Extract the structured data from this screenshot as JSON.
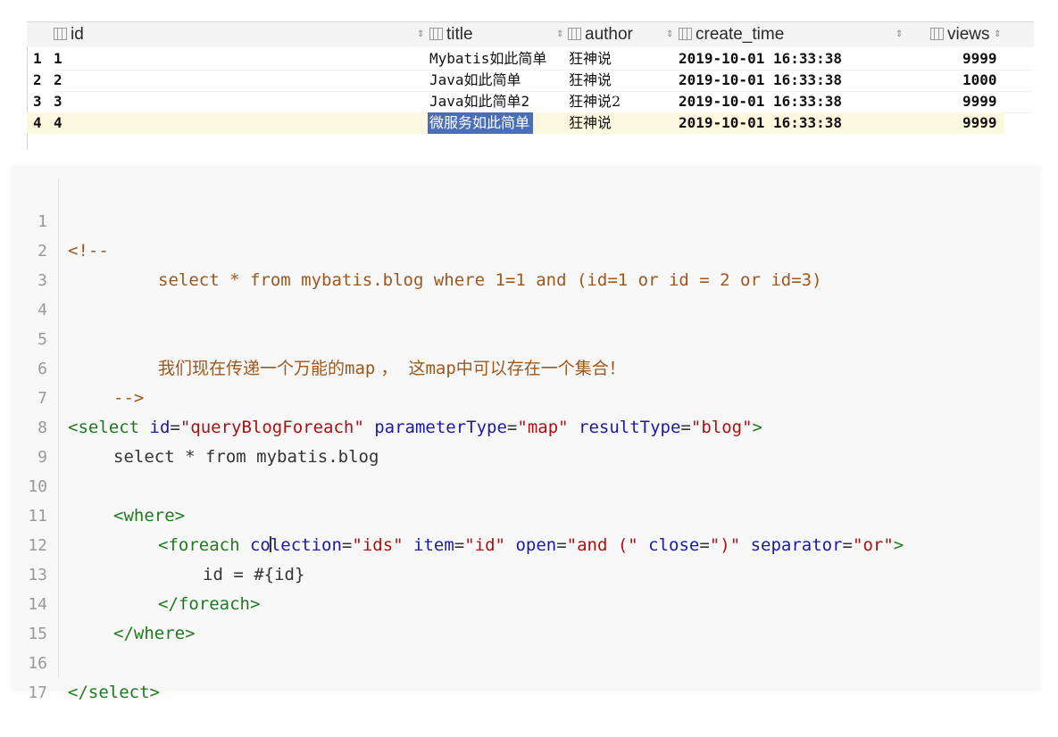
{
  "grid": {
    "columns": [
      {
        "name": "id"
      },
      {
        "name": "title"
      },
      {
        "name": "author"
      },
      {
        "name": "create_time"
      },
      {
        "name": "views"
      }
    ],
    "rows": [
      {
        "num": "1",
        "id": "1",
        "title": "Mybatis如此简单",
        "author": "狂神说",
        "create_time": "2019-10-01 16:33:38",
        "views": "9999"
      },
      {
        "num": "2",
        "id": "2",
        "title": "Java如此简单",
        "author": "狂神说",
        "create_time": "2019-10-01 16:33:38",
        "views": "1000"
      },
      {
        "num": "3",
        "id": "3",
        "title": "Java如此简单2",
        "author": "狂神说2",
        "create_time": "2019-10-01 16:33:38",
        "views": "9999"
      },
      {
        "num": "4",
        "id": "4",
        "title": "微服务如此简单",
        "author": "狂神说",
        "create_time": "2019-10-01 16:33:38",
        "views": "9999"
      }
    ],
    "selected_row": 4
  },
  "code": {
    "line_numbers": [
      "1",
      "2",
      "3",
      "4",
      "5",
      "6",
      "7",
      "8",
      "9",
      "10",
      "11",
      "12",
      "13",
      "14",
      "15",
      "16",
      "17"
    ],
    "l1": "<!--",
    "l2": "select * from mybatis.blog where 1=1 and (id=1 or id = 2 or id=3)",
    "l5a": "我们现在传递一个万能的",
    "l5b": "map",
    "l5c": " ，  这",
    "l5d": "map",
    "l5e": "中可以存在一个集合！",
    "l6": "-->",
    "l7": {
      "open": "<select",
      "a1": " id",
      "v1": "\"queryBlogForeach\"",
      "a2": " parameterType",
      "v2": "\"map\"",
      "a3": " resultType",
      "v3": "\"blog\"",
      "close": ">"
    },
    "l8": "select * from mybatis.blog",
    "l10": "<where>",
    "l11": {
      "open": "<foreach",
      "a1a": " co",
      "a1b": "lection",
      "v1": "\"ids\"",
      "a2": " item",
      "v2": "\"id\"",
      "a3": " open",
      "v3": "\"and (\"",
      "a4": " close",
      "v4": "\")\"",
      "a5": " separator",
      "v5": "\"or\"",
      "close": ">"
    },
    "l12": "id = #{id}",
    "l13": "</foreach>",
    "l14": "</where>",
    "l16": "</select>"
  },
  "colors": {
    "comment": "#a0571b",
    "tag": "#1f7a1f",
    "attr": "#1a1aa6",
    "string": "#a11",
    "selection": "#4a6fb5",
    "selected_row": "#fcf8e0"
  }
}
